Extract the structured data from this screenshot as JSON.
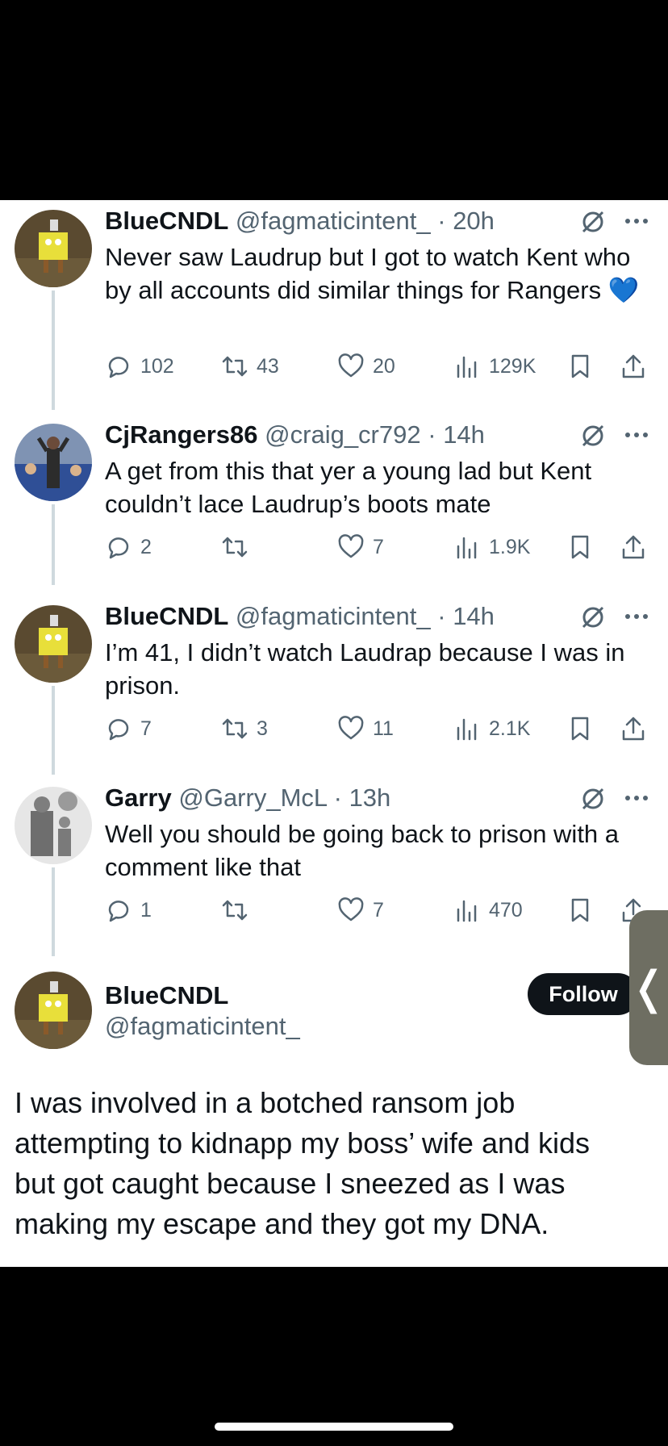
{
  "colors": {
    "text": "#0f1419",
    "secondary": "#536471",
    "thread_line": "#cfd9de",
    "heart_emoji": "#3d7bf0",
    "follow_bg": "#0f1419"
  },
  "replies": [
    {
      "name": "BlueCNDL",
      "handle": "@fagmaticintent_",
      "dot": "·",
      "time": "20h",
      "text": "Never saw Laudrup but I got to watch Kent who by all accounts did similar things for Rangers",
      "emoji": "💙",
      "avatar": "spongebob-avatar",
      "replies": "102",
      "reposts": "43",
      "likes": "20",
      "views": "129K"
    },
    {
      "name": "CjRangers86",
      "handle": "@craig_cr792",
      "dot": "·",
      "time": "14h",
      "text": "A get from this that yer a young lad but Kent couldn’t lace Laudrup’s boots mate",
      "avatar": "crowd-photo-avatar",
      "replies": "2",
      "reposts": "",
      "likes": "7",
      "views": "1.9K"
    },
    {
      "name": "BlueCNDL",
      "handle": "@fagmaticintent_",
      "dot": "·",
      "time": "14h",
      "text": "I’m 41, I didn’t watch Laudrap because I was in prison.",
      "avatar": "spongebob-avatar",
      "replies": "7",
      "reposts": "3",
      "likes": "11",
      "views": "2.1K"
    },
    {
      "name": "Garry",
      "handle": "@Garry_McL",
      "dot": "·",
      "time": "13h",
      "text": "Well you should be going back to prison with a comment like that",
      "avatar": "statue-photo-avatar",
      "replies": "1",
      "reposts": "",
      "likes": "7",
      "views": "470"
    }
  ],
  "main_tweet": {
    "name": "BlueCNDL",
    "handle": "@fagmaticintent_",
    "follow_label": "Follow",
    "text": "I was involved in a botched ransom job attempting to kidnapp my boss’ wife and kids but got caught because I sneezed as I was making my escape and they got my DNA."
  },
  "side_handle_glyph": "❬"
}
